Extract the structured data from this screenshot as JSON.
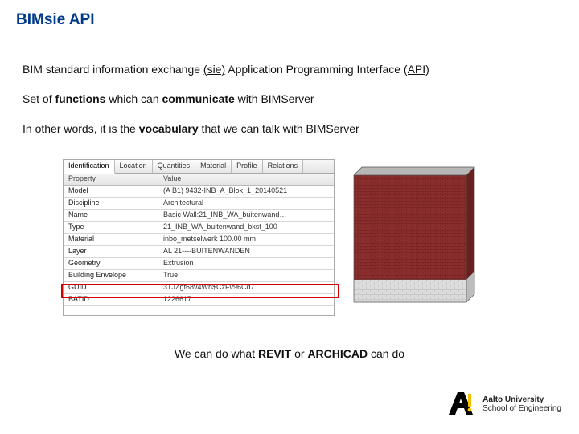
{
  "title": "BIMsie API",
  "line1": {
    "t1": "BIM standard information exchange ",
    "u1": "(sie)",
    "t2": " Application Programming Interface ",
    "u2": "(API)"
  },
  "line2": {
    "t1": "Set of ",
    "b1": "functions",
    "t2": " which can ",
    "b2": "communicate",
    "t3": " with BIMServer"
  },
  "line3": {
    "t1": "In other words, it is the ",
    "b1": "vocabulary",
    "t2": " that we can talk with BIMServer"
  },
  "tabs": [
    "Identification",
    "Location",
    "Quantities",
    "Material",
    "Profile",
    "Relations"
  ],
  "headers": {
    "prop": "Property",
    "val": "Value"
  },
  "rows": [
    {
      "p": "Model",
      "v": "(A B1) 9432-INB_A_Blok_1_20140521"
    },
    {
      "p": "Discipline",
      "v": "Architectural"
    },
    {
      "p": "Name",
      "v": "Basic Wall:21_INB_WA_buitenwand…"
    },
    {
      "p": "Type",
      "v": "21_INB_WA_buitenwand_bkst_100"
    },
    {
      "p": "Material",
      "v": "inbo_metselwerk 100.00 mm"
    },
    {
      "p": "Layer",
      "v": "AL 21----BUITENWANDEN"
    },
    {
      "p": "Geometry",
      "v": "Extrusion"
    },
    {
      "p": "Building Envelope",
      "v": "True"
    },
    {
      "p": "GUID",
      "v": "3TJZgf68v4Wh$CzFv96Cd7"
    },
    {
      "p": "BATID",
      "v": "1226617"
    }
  ],
  "caption": {
    "t1": "We can do what ",
    "b1": "REVIT",
    "t2": " or ",
    "b2": "ARCHICAD",
    "t3": " can do"
  },
  "logo": {
    "line1": "Aalto University",
    "line2": "School of Engineering"
  }
}
